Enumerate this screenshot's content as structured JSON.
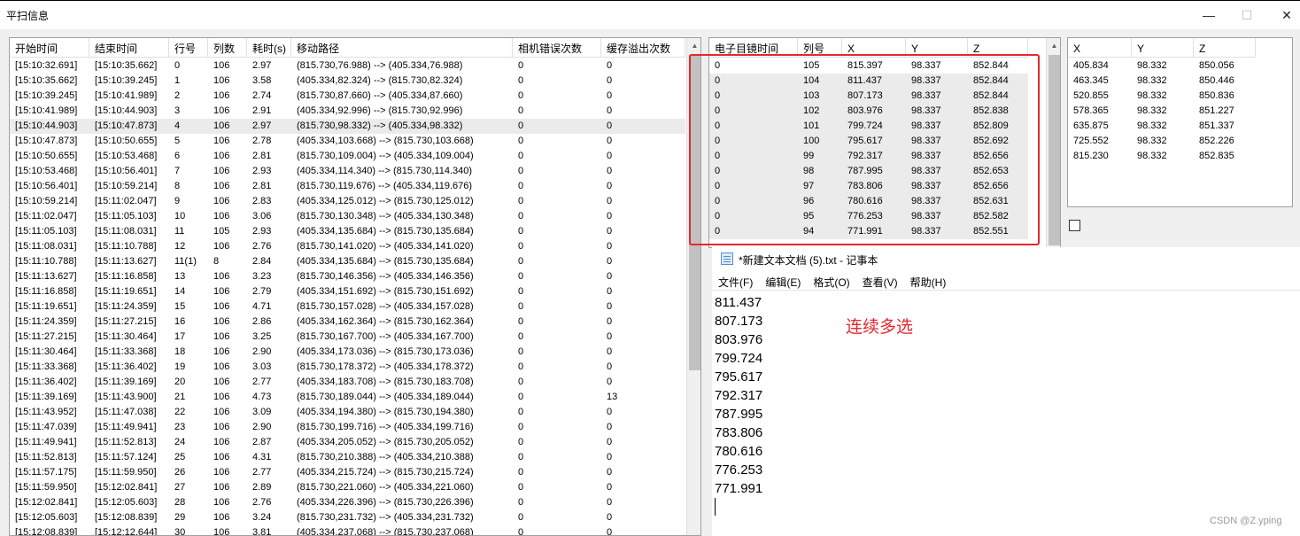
{
  "window": {
    "title": "平扫信息",
    "minimize": "—",
    "maximize": "☐",
    "close": "✕"
  },
  "left_grid": {
    "columns": [
      "开始时间",
      "结束时间",
      "行号",
      "列数",
      "耗时(s)",
      "移动路径",
      "相机错误次数",
      "缓存溢出次数"
    ],
    "rows": [
      [
        "[15:10:32.691]",
        "[15:10:35.662]",
        "0",
        "106",
        "2.97",
        "(815.730,76.988) --> (405.334,76.988)",
        "0",
        "0"
      ],
      [
        "[15:10:35.662]",
        "[15:10:39.245]",
        "1",
        "106",
        "3.58",
        "(405.334,82.324) --> (815.730,82.324)",
        "0",
        "0"
      ],
      [
        "[15:10:39.245]",
        "[15:10:41.989]",
        "2",
        "106",
        "2.74",
        "(815.730,87.660) --> (405.334,87.660)",
        "0",
        "0"
      ],
      [
        "[15:10:41.989]",
        "[15:10:44.903]",
        "3",
        "106",
        "2.91",
        "(405.334,92.996) --> (815.730,92.996)",
        "0",
        "0"
      ],
      [
        "[15:10:44.903]",
        "[15:10:47.873]",
        "4",
        "106",
        "2.97",
        "(815.730,98.332) --> (405.334,98.332)",
        "0",
        "0"
      ],
      [
        "[15:10:47.873]",
        "[15:10:50.655]",
        "5",
        "106",
        "2.78",
        "(405.334,103.668) --> (815.730,103.668)",
        "0",
        "0"
      ],
      [
        "[15:10:50.655]",
        "[15:10:53.468]",
        "6",
        "106",
        "2.81",
        "(815.730,109.004) --> (405.334,109.004)",
        "0",
        "0"
      ],
      [
        "[15:10:53.468]",
        "[15:10:56.401]",
        "7",
        "106",
        "2.93",
        "(405.334,114.340) --> (815.730,114.340)",
        "0",
        "0"
      ],
      [
        "[15:10:56.401]",
        "[15:10:59.214]",
        "8",
        "106",
        "2.81",
        "(815.730,119.676) --> (405.334,119.676)",
        "0",
        "0"
      ],
      [
        "[15:10:59.214]",
        "[15:11:02.047]",
        "9",
        "106",
        "2.83",
        "(405.334,125.012) --> (815.730,125.012)",
        "0",
        "0"
      ],
      [
        "[15:11:02.047]",
        "[15:11:05.103]",
        "10",
        "106",
        "3.06",
        "(815.730,130.348) --> (405.334,130.348)",
        "0",
        "0"
      ],
      [
        "[15:11:05.103]",
        "[15:11:08.031]",
        "11",
        "105",
        "2.93",
        "(405.334,135.684) --> (815.730,135.684)",
        "0",
        "0"
      ],
      [
        "[15:11:08.031]",
        "[15:11:10.788]",
        "12",
        "106",
        "2.76",
        "(815.730,141.020) --> (405.334,141.020)",
        "0",
        "0"
      ],
      [
        "[15:11:10.788]",
        "[15:11:13.627]",
        "11(1)",
        "8",
        "2.84",
        "(405.334,135.684) --> (815.730,135.684)",
        "0",
        "0"
      ],
      [
        "[15:11:13.627]",
        "[15:11:16.858]",
        "13",
        "106",
        "3.23",
        "(815.730,146.356) --> (405.334,146.356)",
        "0",
        "0"
      ],
      [
        "[15:11:16.858]",
        "[15:11:19.651]",
        "14",
        "106",
        "2.79",
        "(405.334,151.692) --> (815.730,151.692)",
        "0",
        "0"
      ],
      [
        "[15:11:19.651]",
        "[15:11:24.359]",
        "15",
        "106",
        "4.71",
        "(815.730,157.028) --> (405.334,157.028)",
        "0",
        "0"
      ],
      [
        "[15:11:24.359]",
        "[15:11:27.215]",
        "16",
        "106",
        "2.86",
        "(405.334,162.364) --> (815.730,162.364)",
        "0",
        "0"
      ],
      [
        "[15:11:27.215]",
        "[15:11:30.464]",
        "17",
        "106",
        "3.25",
        "(815.730,167.700) --> (405.334,167.700)",
        "0",
        "0"
      ],
      [
        "[15:11:30.464]",
        "[15:11:33.368]",
        "18",
        "106",
        "2.90",
        "(405.334,173.036) --> (815.730,173.036)",
        "0",
        "0"
      ],
      [
        "[15:11:33.368]",
        "[15:11:36.402]",
        "19",
        "106",
        "3.03",
        "(815.730,178.372) --> (405.334,178.372)",
        "0",
        "0"
      ],
      [
        "[15:11:36.402]",
        "[15:11:39.169]",
        "20",
        "106",
        "2.77",
        "(405.334,183.708) --> (815.730,183.708)",
        "0",
        "0"
      ],
      [
        "[15:11:39.169]",
        "[15:11:43.900]",
        "21",
        "106",
        "4.73",
        "(815.730,189.044) --> (405.334,189.044)",
        "0",
        "13"
      ],
      [
        "[15:11:43.952]",
        "[15:11:47.038]",
        "22",
        "106",
        "3.09",
        "(405.334,194.380) --> (815.730,194.380)",
        "0",
        "0"
      ],
      [
        "[15:11:47.039]",
        "[15:11:49.941]",
        "23",
        "106",
        "2.90",
        "(815.730,199.716) --> (405.334,199.716)",
        "0",
        "0"
      ],
      [
        "[15:11:49.941]",
        "[15:11:52.813]",
        "24",
        "106",
        "2.87",
        "(405.334,205.052) --> (815.730,205.052)",
        "0",
        "0"
      ],
      [
        "[15:11:52.813]",
        "[15:11:57.124]",
        "25",
        "106",
        "4.31",
        "(815.730,210.388) --> (405.334,210.388)",
        "0",
        "0"
      ],
      [
        "[15:11:57.175]",
        "[15:11:59.950]",
        "26",
        "106",
        "2.77",
        "(405.334,215.724) --> (815.730,215.724)",
        "0",
        "0"
      ],
      [
        "[15:11:59.950]",
        "[15:12:02.841]",
        "27",
        "106",
        "2.89",
        "(815.730,221.060) --> (405.334,221.060)",
        "0",
        "0"
      ],
      [
        "[15:12:02.841]",
        "[15:12:05.603]",
        "28",
        "106",
        "2.76",
        "(405.334,226.396) --> (815.730,226.396)",
        "0",
        "0"
      ],
      [
        "[15:12:05.603]",
        "[15:12:08.839]",
        "29",
        "106",
        "3.24",
        "(815.730,231.732) --> (405.334,231.732)",
        "0",
        "0"
      ],
      [
        "[15:12:08.839]",
        "[15:12:12.644]",
        "30",
        "106",
        "3.81",
        "(405.334,237.068) --> (815.730,237.068)",
        "0",
        "0"
      ]
    ]
  },
  "middle_grid": {
    "columns": [
      "电子目镜时间",
      "列号",
      "X",
      "Y",
      "Z"
    ],
    "rows": [
      [
        "0",
        "105",
        "815.397",
        "98.337",
        "852.844"
      ],
      [
        "0",
        "104",
        "811.437",
        "98.337",
        "852.844"
      ],
      [
        "0",
        "103",
        "807.173",
        "98.337",
        "852.844"
      ],
      [
        "0",
        "102",
        "803.976",
        "98.337",
        "852.838"
      ],
      [
        "0",
        "101",
        "799.724",
        "98.337",
        "852.809"
      ],
      [
        "0",
        "100",
        "795.617",
        "98.337",
        "852.692"
      ],
      [
        "0",
        "99",
        "792.317",
        "98.337",
        "852.656"
      ],
      [
        "0",
        "98",
        "787.995",
        "98.337",
        "852.653"
      ],
      [
        "0",
        "97",
        "783.806",
        "98.337",
        "852.656"
      ],
      [
        "0",
        "96",
        "780.616",
        "98.337",
        "852.631"
      ],
      [
        "0",
        "95",
        "776.253",
        "98.337",
        "852.582"
      ],
      [
        "0",
        "94",
        "771.991",
        "98.337",
        "852.551"
      ]
    ]
  },
  "right_grid": {
    "columns": [
      "X",
      "Y",
      "Z"
    ],
    "rows": [
      [
        "405.834",
        "98.332",
        "850.056"
      ],
      [
        "463.345",
        "98.332",
        "850.446"
      ],
      [
        "520.855",
        "98.332",
        "850.836"
      ],
      [
        "578.365",
        "98.332",
        "851.227"
      ],
      [
        "635.875",
        "98.332",
        "851.337"
      ],
      [
        "725.552",
        "98.332",
        "852.226"
      ],
      [
        "815.230",
        "98.332",
        "852.835"
      ]
    ]
  },
  "notepad": {
    "title": "*新建文本文档 (5).txt - 记事本",
    "menu": [
      "文件(F)",
      "编辑(E)",
      "格式(O)",
      "查看(V)",
      "帮助(H)"
    ],
    "lines": [
      "811.437",
      "807.173",
      "803.976",
      "799.724",
      "795.617",
      "792.317",
      "787.995",
      "783.806",
      "780.616",
      "776.253",
      "771.991"
    ]
  },
  "annotation": "连续多选",
  "watermark": "CSDN @Z.yping",
  "colors": {
    "annotation_red": "#e8262d",
    "row_highlight": "#ebebeb"
  }
}
